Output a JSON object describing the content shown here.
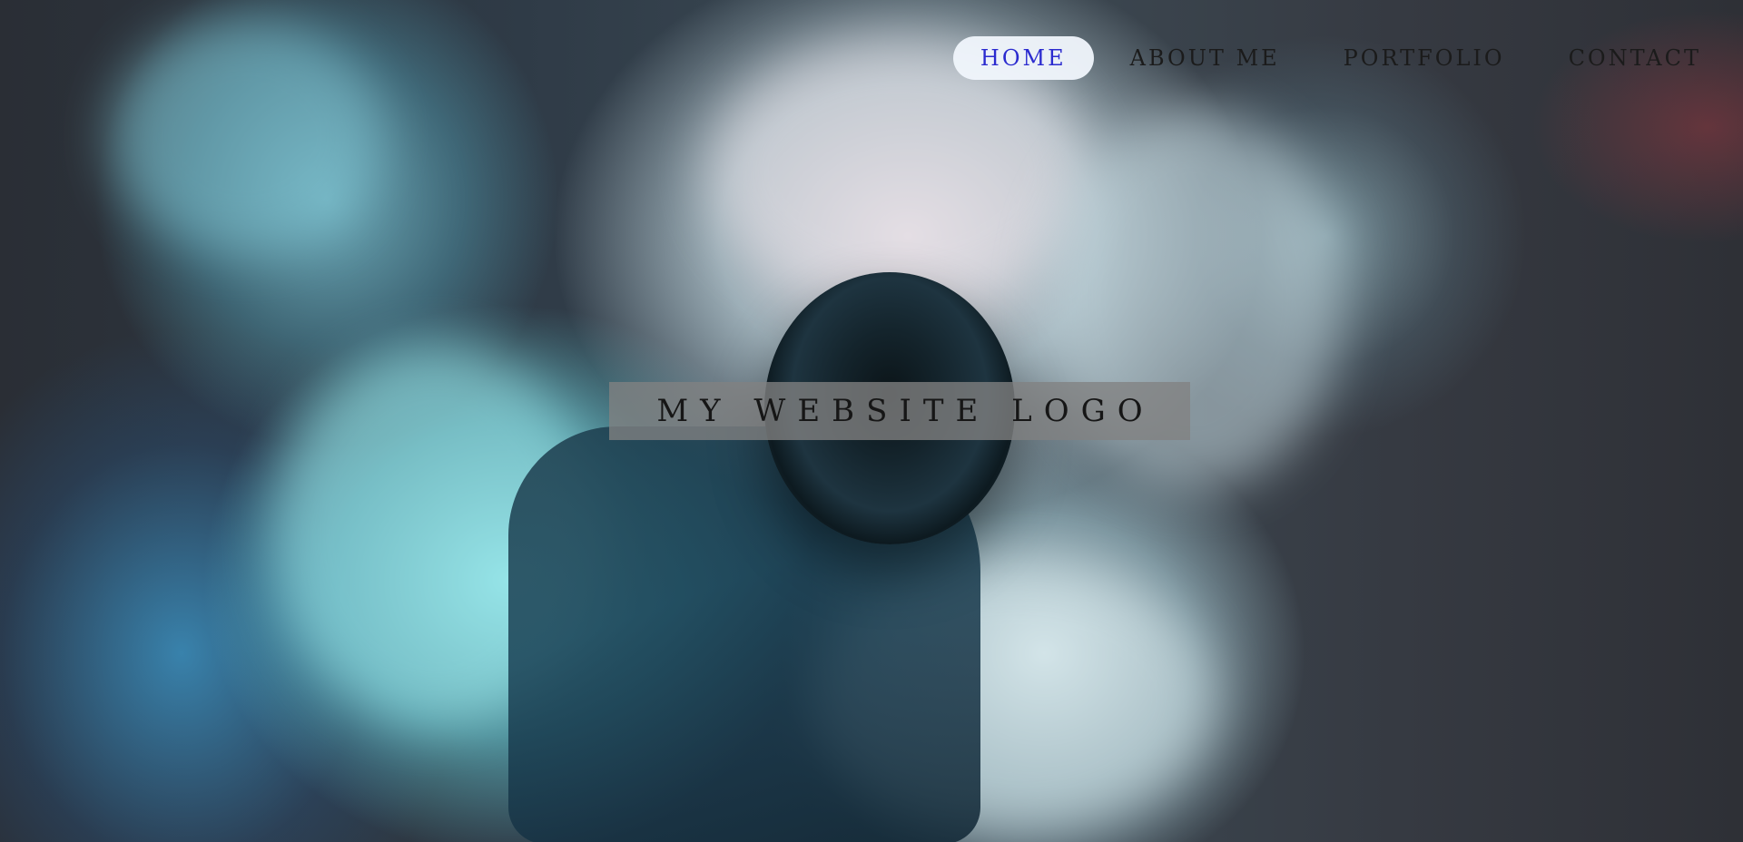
{
  "nav": {
    "items": [
      {
        "label": "HOME",
        "active": true
      },
      {
        "label": "ABOUT ME",
        "active": false
      },
      {
        "label": "PORTFOLIO",
        "active": false
      },
      {
        "label": "CONTACT",
        "active": false
      }
    ]
  },
  "hero": {
    "logo_text": "MY WEBSITE LOGO"
  },
  "colors": {
    "active_nav_text": "#2b2bcf",
    "active_nav_bg": "#f0f6fc",
    "nav_text": "#1b1b1b",
    "logo_box_bg": "#828282"
  }
}
